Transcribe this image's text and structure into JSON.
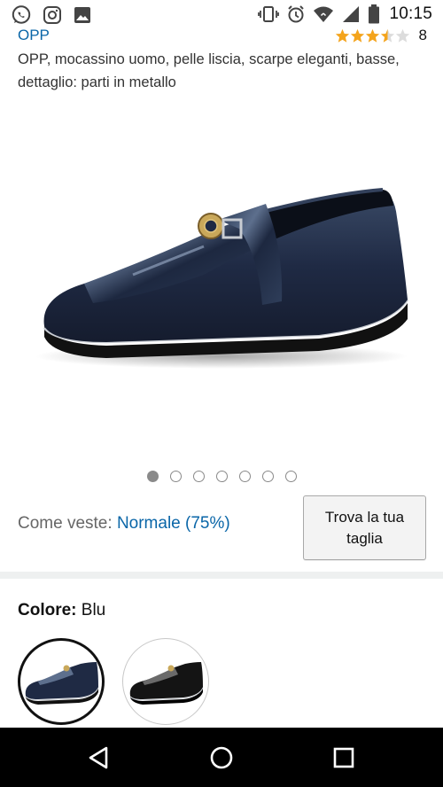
{
  "status_bar": {
    "time": "10:15",
    "left_icons": [
      "whatsapp-icon",
      "instagram-icon",
      "gallery-icon"
    ],
    "right_icons": [
      "vibrate-icon",
      "alarm-icon",
      "wifi-icon",
      "signal-icon",
      "battery-icon"
    ]
  },
  "product": {
    "brand": "OPP",
    "rating": 3.5,
    "rating_count": "8",
    "title": "OPP, mocassino uomo, pelle liscia, scarpe eleganti, basse, dettaglio: parti in metallo",
    "image_icon": "loafer-shoe-image",
    "image_count": 7,
    "active_image_index": 0
  },
  "fit": {
    "label": "Come veste: ",
    "value": "Normale (75%)",
    "button_label_line1": "Trova la tua",
    "button_label_line2": "taglia"
  },
  "color": {
    "label": "Colore:",
    "value": " Blu",
    "swatches": [
      {
        "name": "Blu",
        "selected": true,
        "color": "#1f2a44"
      },
      {
        "name": "Nero",
        "selected": false,
        "color": "#111111"
      }
    ]
  },
  "nav_bar": {
    "buttons": [
      "back-icon",
      "home-icon",
      "recents-icon"
    ]
  },
  "colors": {
    "link": "#0a66a8",
    "star": "#f4a41c",
    "shoe_blue": "#1f2a44"
  }
}
